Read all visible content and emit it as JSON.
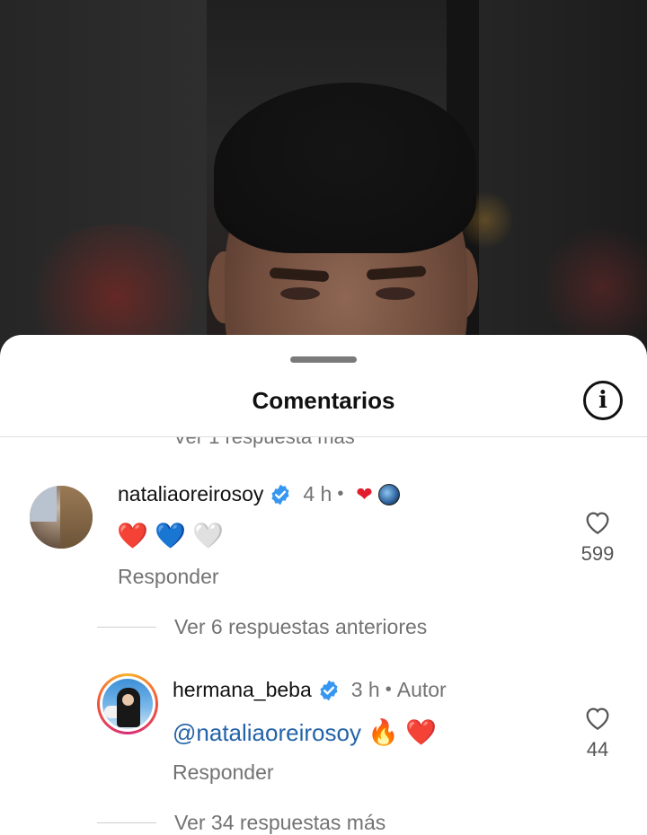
{
  "sheet": {
    "title": "Comentarios",
    "info_icon": "info-icon",
    "clipped_link": "Ver 1 respuesta más"
  },
  "comments": [
    {
      "username": "nataliaoreirosoy",
      "verified": true,
      "time": "4 h",
      "separator": "•",
      "text_emojis": [
        "❤️",
        "💙",
        "🤍"
      ],
      "reply_label": "Responder",
      "likes": "599",
      "creator_liked": true
    },
    {
      "username": "hermana_beba",
      "verified": true,
      "time": "3 h",
      "separator": "•",
      "author_label": "Autor",
      "mention": "@nataliaoreirosoy",
      "text_emojis": [
        "🔥",
        "❤️"
      ],
      "reply_label": "Responder",
      "likes": "44"
    }
  ],
  "threads": {
    "previous_replies": "Ver 6 respuestas anteriores",
    "more_replies": "Ver 34 respuestas más"
  },
  "colors": {
    "verified": "#3797f0",
    "mention": "#2463a8",
    "heart": "#e11d2e",
    "secondary_text": "#737373"
  }
}
